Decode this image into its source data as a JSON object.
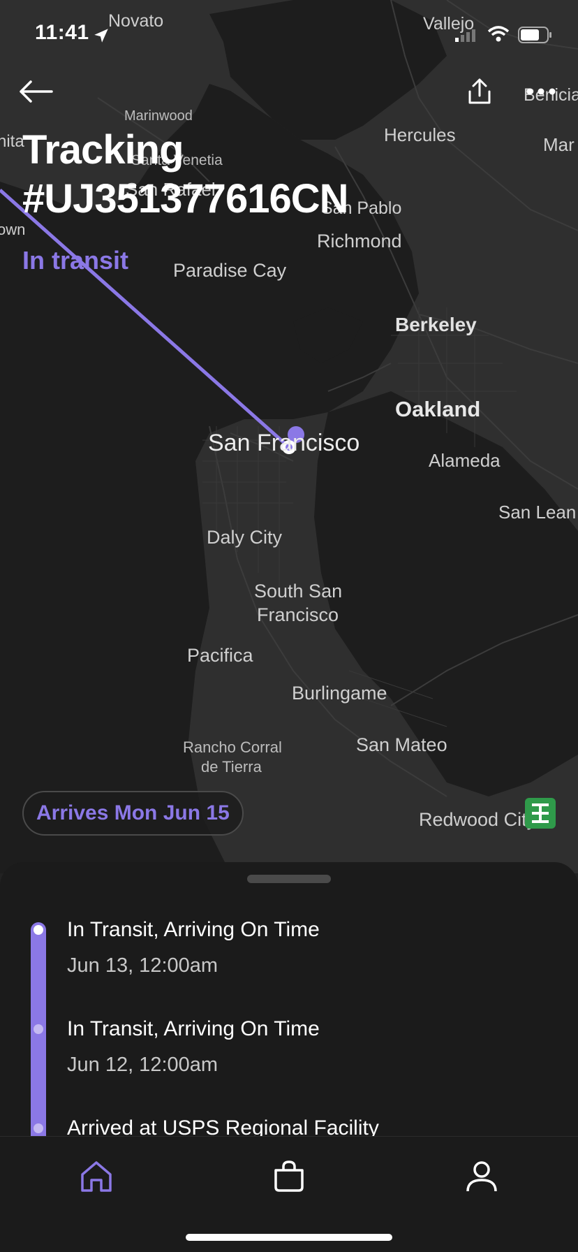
{
  "status_bar": {
    "time": "11:41"
  },
  "header": {
    "title_line1": "Tracking",
    "title_line2": "#UJ351377616CN",
    "status": "In transit"
  },
  "map": {
    "labels": {
      "novato": "Novato",
      "vallejo": "Vallejo",
      "benicia": "Benicia",
      "marinwood": "Marinwood",
      "hercules": "Hercules",
      "martinez": "Mar",
      "santa_venetia": "Santa Venetia",
      "san_rafael": "San Rafael",
      "san_pablo": "San Pablo",
      "richmond": "Richmond",
      "paradise_cay": "Paradise Cay",
      "berkeley": "Berkeley",
      "oakland": "Oakland",
      "san_francisco": "San Francisco",
      "alameda": "Alameda",
      "san_leandro": "San Lean",
      "daly_city": "Daly City",
      "south_sf_1": "South San",
      "south_sf_2": "Francisco",
      "pacifica": "Pacifica",
      "burlingame": "Burlingame",
      "rancho_1": "Rancho Corral",
      "rancho_2": "de Tierra",
      "san_mateo": "San Mateo",
      "redwood_city": "Redwood City",
      "left_edge_1": "nita",
      "left_edge_2": "own"
    },
    "route_color": "#8b78e6",
    "carrier_icon": "china-post-icon"
  },
  "arrives_badge": "Arrives Mon Jun 15",
  "timeline": [
    {
      "title": "In Transit, Arriving On Time",
      "date": "Jun 13, 12:00am"
    },
    {
      "title": "In Transit, Arriving On Time",
      "date": "Jun 12, 12:00am"
    },
    {
      "title": "Arrived at USPS Regional Facility",
      "date": ""
    }
  ],
  "tabs": [
    {
      "icon": "home-icon",
      "active": true
    },
    {
      "icon": "bag-icon",
      "active": false
    },
    {
      "icon": "profile-icon",
      "active": false
    }
  ],
  "colors": {
    "accent": "#8b78e6",
    "background": "#1b1b1b",
    "map_land": "#2e2e2e",
    "map_water": "#1c1c1c"
  }
}
